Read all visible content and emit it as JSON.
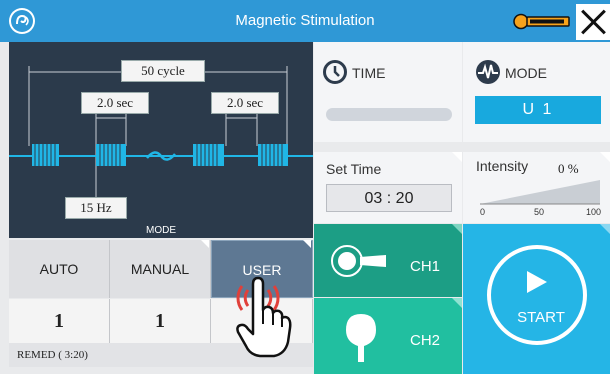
{
  "titlebar": {
    "title": "Magnetic Stimulation",
    "logo_icon": "app-logo",
    "key_icon": "key-icon",
    "close_icon": "close-icon"
  },
  "waveform": {
    "cycle_label": "50 cycle",
    "on_time_label": "2.0 sec",
    "off_time_label": "2.0 sec",
    "frequency_label": "15 Hz"
  },
  "time_card": {
    "title": "TIME",
    "icon": "clock-icon",
    "progress": 0
  },
  "mode_card": {
    "title": "MODE",
    "icon": "pulse-icon",
    "value": "U 1"
  },
  "set_time": {
    "title": "Set Time",
    "value": "03 : 20"
  },
  "intensity": {
    "title": "Intensity",
    "value": "0 %",
    "scale": [
      "0",
      "50",
      "100"
    ]
  },
  "mode_selector": {
    "header": "MODE",
    "buttons": [
      {
        "label": "AUTO",
        "count": "1"
      },
      {
        "label": "MANUAL",
        "count": "1"
      },
      {
        "label": "USER",
        "count": ""
      }
    ],
    "active": "USER"
  },
  "remed": "REMED ( 3:20)",
  "channels": {
    "ch1": "CH1",
    "ch2": "CH2"
  },
  "start": {
    "label": "START",
    "icon": "play-icon"
  },
  "colors": {
    "title_bar": "#2f98d6",
    "wave_panel": "#2b3a4b",
    "wave_line": "#20b6e6",
    "ch1": "#1c9e85",
    "ch2": "#21bfa0",
    "start": "#25b5e6",
    "user_active": "#5e7893"
  }
}
